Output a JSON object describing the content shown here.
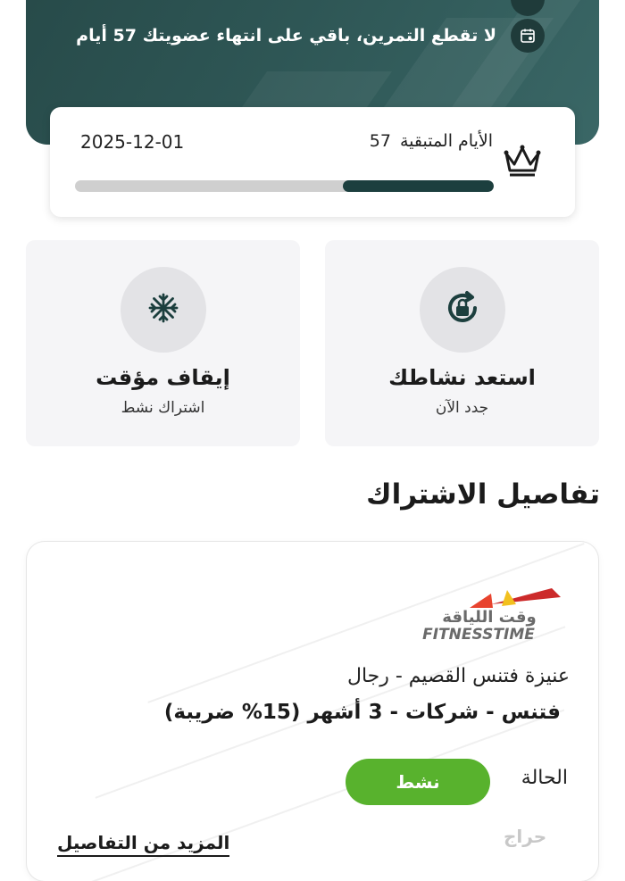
{
  "membership": {
    "reminder_text": "لا تقطع التمرين، باقي على انتهاء عضويتك  57 أيام",
    "days_remaining_label": "الأيام المتبقية",
    "days_remaining": "57",
    "end_date": "2025-12-01",
    "progress_fraction": 0.36
  },
  "actions": {
    "renew": {
      "title": "استعد نشاطك",
      "subtitle": "جدد الآن",
      "icon": "renew-lock-icon"
    },
    "freeze": {
      "title": "إيقاف مؤقت",
      "subtitle": "اشتراك نشط",
      "icon": "snowflake-icon"
    }
  },
  "details": {
    "section_title": "تفاصيل الاشتراك",
    "logo_text": "FITNESSTIME",
    "logo_arabic": "وقت اللياقة",
    "branch": "عنيزة فتنس القصيم - رجال",
    "plan": "فتنس - شركات - 3 أشهر (15% ضريبة)",
    "status_label": "الحالة",
    "status_value": "نشط",
    "more_link": "المزيد من التفاصيل"
  },
  "watermark": "حراج",
  "colors": {
    "hero_bg": "#2e5655",
    "progress_fill": "#1c3f3e",
    "status_green": "#58b22d",
    "card_bg": "#f5f5f7"
  }
}
